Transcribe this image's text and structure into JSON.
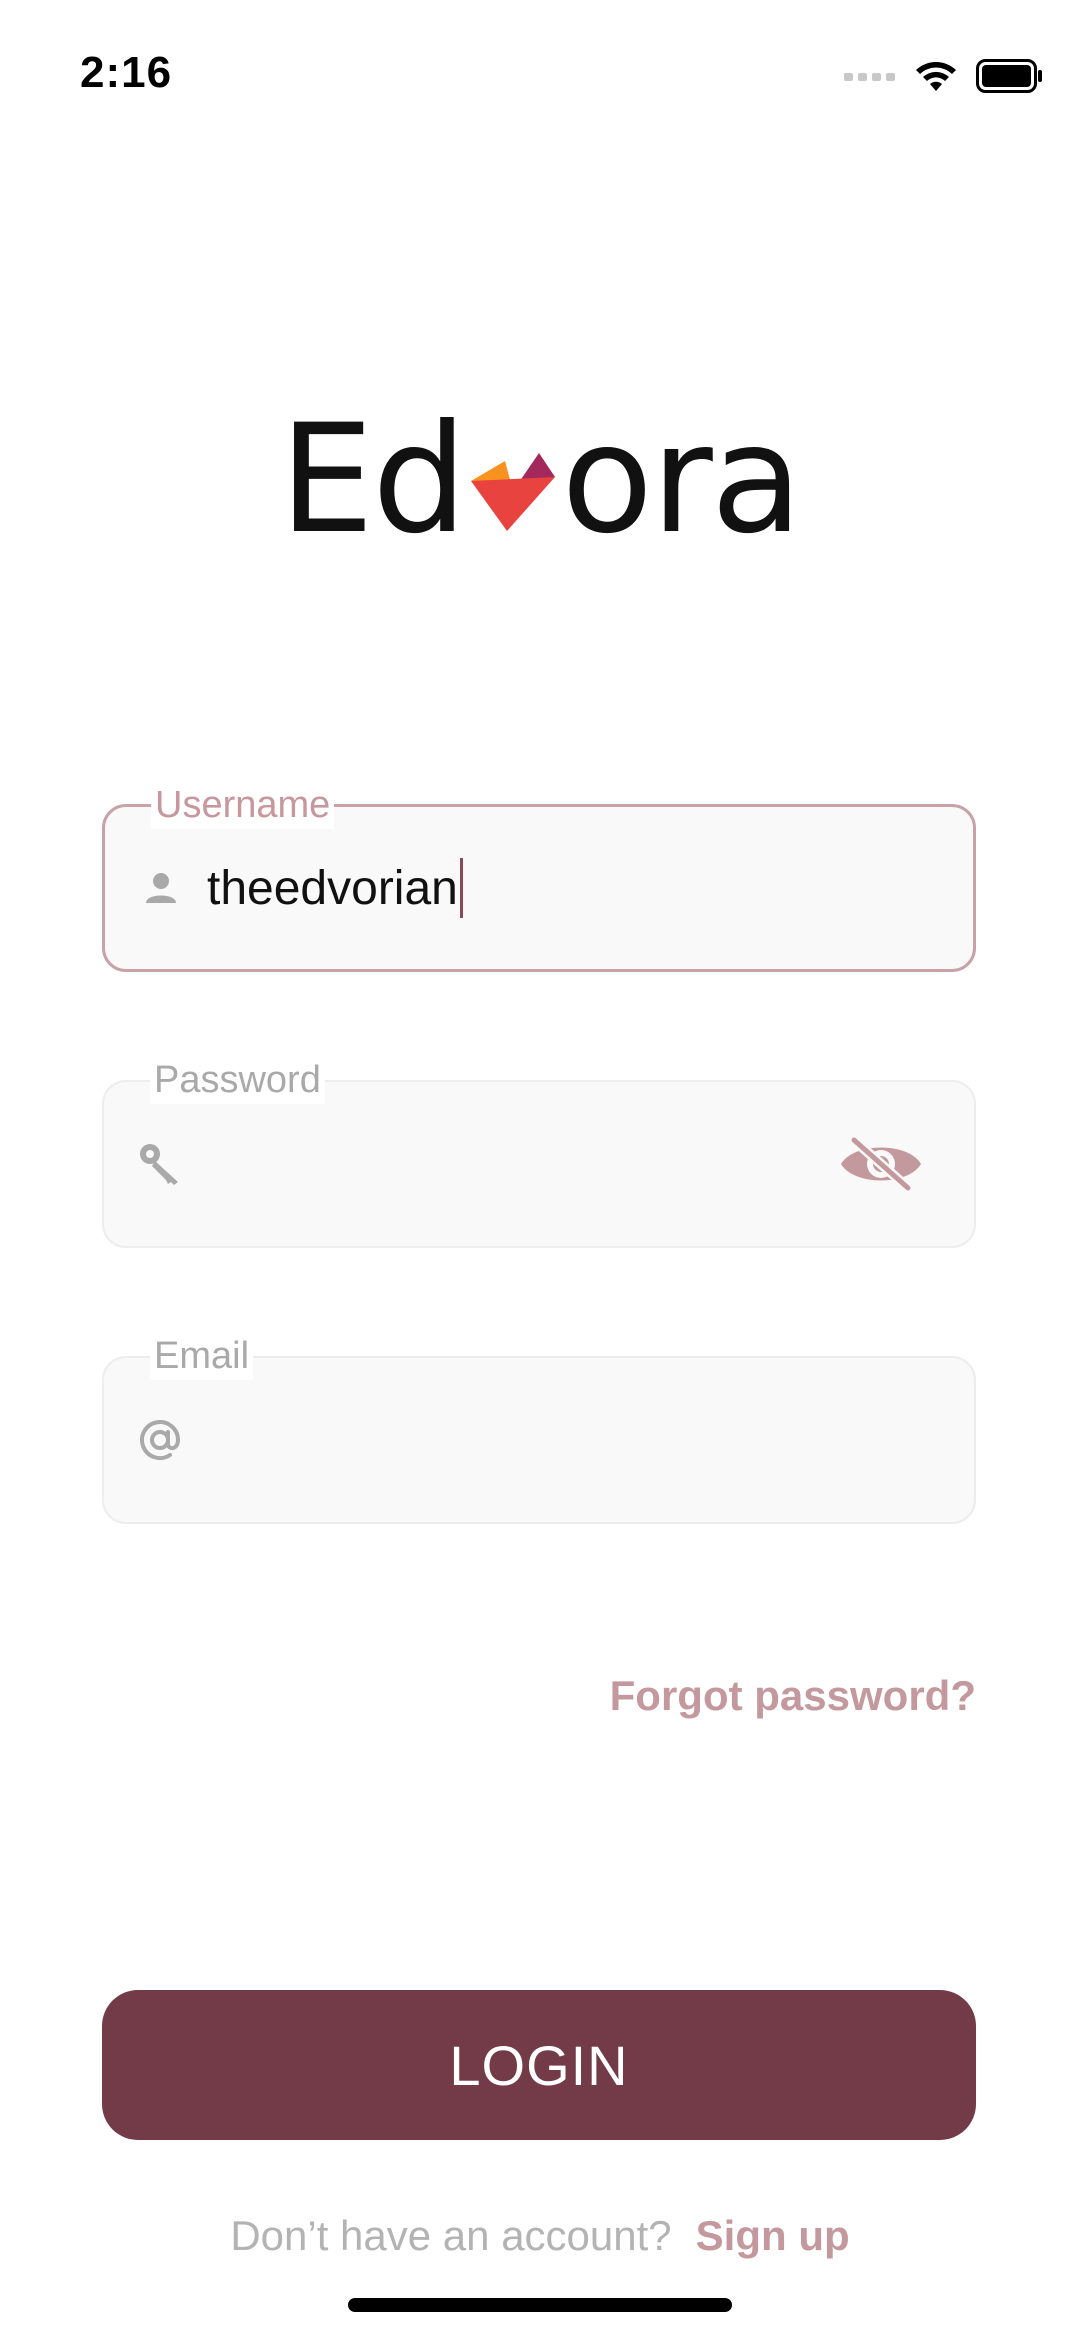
{
  "status_bar": {
    "time": "2:16",
    "icons": [
      "signal-icon",
      "wifi-icon",
      "battery-icon"
    ]
  },
  "logo": {
    "text_before": "Ed",
    "text_after": "ora",
    "mark_colors": [
      "#f7931e",
      "#e8433f",
      "#a3285c"
    ]
  },
  "form": {
    "username": {
      "label": "Username",
      "value": "theedvorian",
      "icon": "person-icon"
    },
    "password": {
      "label": "Password",
      "value": "",
      "icon": "key-icon",
      "toggle_icon": "eye-off-icon"
    },
    "email": {
      "label": "Email",
      "value": "",
      "icon": "at-icon"
    }
  },
  "forgot_password": "Forgot password?",
  "login_button": "LOGIN",
  "signup": {
    "prompt": "Don’t have an account?",
    "link": "Sign up"
  },
  "colors": {
    "primary": "#733a47",
    "accent_text": "#c4999e",
    "focus_border": "#c7a2a6",
    "field_background": "#f9f9f9"
  }
}
